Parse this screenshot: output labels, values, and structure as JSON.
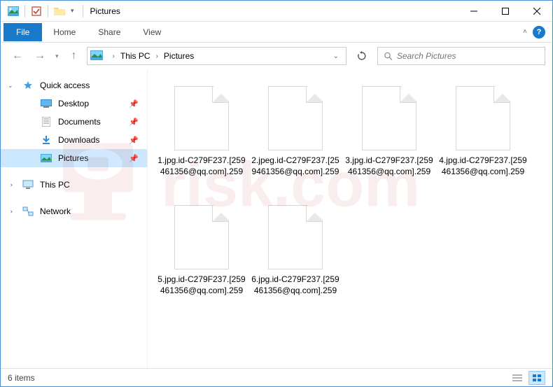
{
  "titlebar": {
    "title": "Pictures"
  },
  "ribbon": {
    "file": "File",
    "tabs": [
      "Home",
      "Share",
      "View"
    ]
  },
  "address": {
    "segments": [
      "This PC",
      "Pictures"
    ]
  },
  "search": {
    "placeholder": "Search Pictures"
  },
  "sidebar": {
    "quick_access": "Quick access",
    "items": [
      {
        "label": "Desktop",
        "pinned": true
      },
      {
        "label": "Documents",
        "pinned": true
      },
      {
        "label": "Downloads",
        "pinned": true
      },
      {
        "label": "Pictures",
        "pinned": true,
        "selected": true
      }
    ],
    "this_pc": "This PC",
    "network": "Network"
  },
  "files": [
    "1.jpg.id-C279F237.[259461356@qq.com].259",
    "2.jpeg.id-C279F237.[259461356@qq.com].259",
    "3.jpg.id-C279F237.[259461356@qq.com].259",
    "4.jpg.id-C279F237.[259461356@qq.com].259",
    "5.jpg.id-C279F237.[259461356@qq.com].259",
    "6.jpg.id-C279F237.[259461356@qq.com].259"
  ],
  "status": {
    "count_label": "6 items"
  }
}
